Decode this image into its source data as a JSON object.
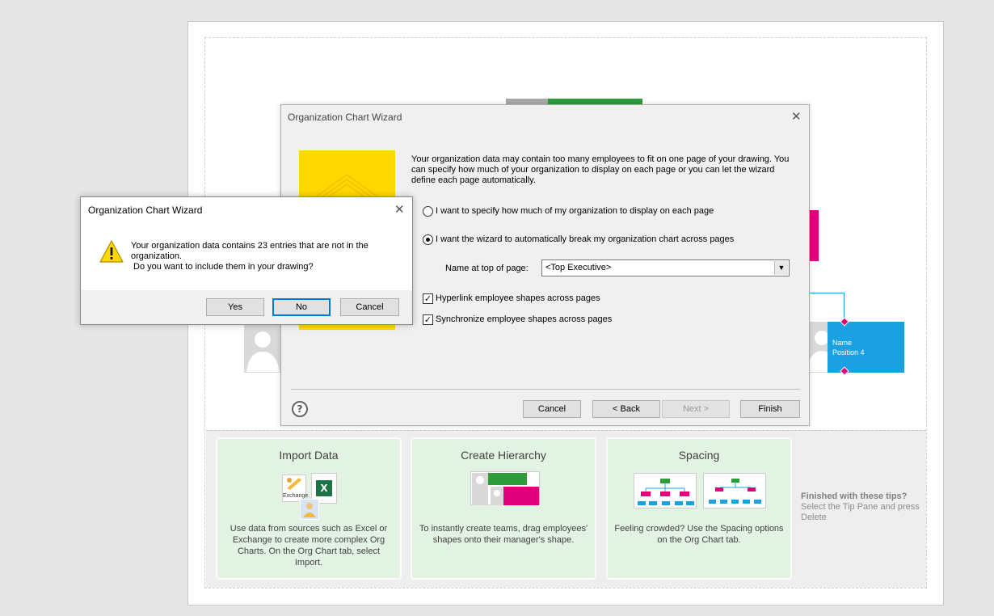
{
  "tips": {
    "cards": [
      {
        "title": "Import Data",
        "text": "Use data from sources such as Excel or Exchange to create more complex Org Charts. On the Org Chart tab, select Import.",
        "icon_label": "Exchange"
      },
      {
        "title": "Create Hierarchy",
        "text": "To instantly create teams, drag employees' shapes onto their manager's shape."
      },
      {
        "title": "Spacing",
        "text": "Feeling crowded? Use the Spacing options on the Org Chart tab."
      }
    ],
    "finished_title": "Finished with these tips?",
    "finished_text": "Select the Tip Pane and press Delete"
  },
  "canvas": {
    "shape_name": "Name",
    "shape_position": "Position 4"
  },
  "wizard": {
    "title": "Organization Chart Wizard",
    "intro": "Your organization data may contain too many employees to fit on one page of your drawing.  You can specify how much of your organization to display on each page or you can let the wizard define each page automatically.",
    "option_manual": "I want to specify how much of my organization to display on each page",
    "option_auto": "I want the wizard to automatically break my organization chart across pages",
    "name_label": "Name at top of page:",
    "name_value": "<Top Executive>",
    "hyperlink_label": "Hyperlink employee shapes across pages",
    "sync_label": "Synchronize employee shapes across pages",
    "help": "?",
    "buttons": {
      "cancel": "Cancel",
      "back": "< Back",
      "next": "Next >",
      "finish": "Finish"
    }
  },
  "message": {
    "title": "Organization Chart Wizard",
    "line1": "Your organization data contains 23 entries that are not in the organization.",
    "line2": " Do you want to include them in your drawing?",
    "buttons": {
      "yes": "Yes",
      "no": "No",
      "cancel": "Cancel"
    }
  },
  "colors": {
    "green": "#2e9c3a",
    "magenta": "#e0007a",
    "blue": "#1ba1e2",
    "yellow": "#ffd800",
    "focus": "#0078d7"
  }
}
